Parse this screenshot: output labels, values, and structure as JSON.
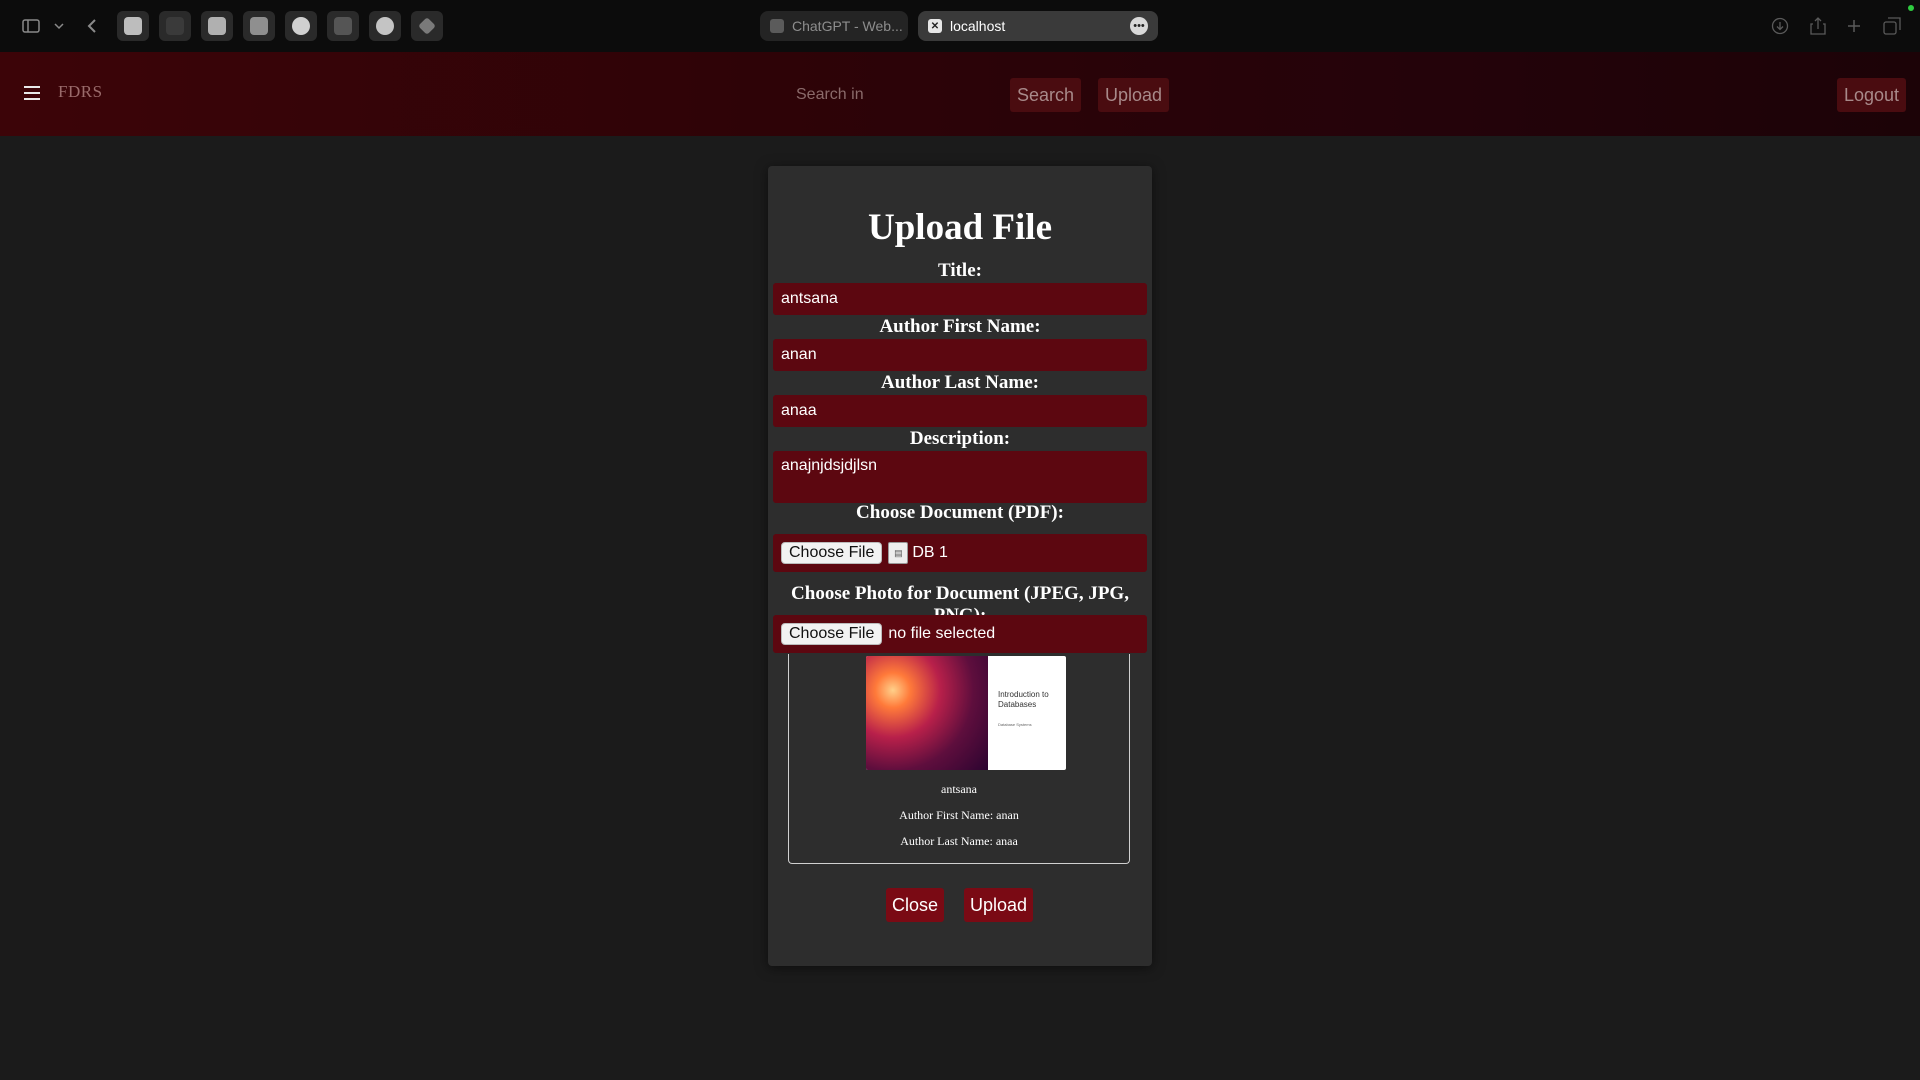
{
  "browser": {
    "tabs": [
      {
        "label": "ChatGPT - Web..."
      },
      {
        "label": "localhost"
      }
    ],
    "tab_more_icon": "ellipsis-icon"
  },
  "navbar": {
    "logo": "FDRS",
    "search_placeholder": "Search in",
    "search_button": "Search",
    "upload_button": "Upload",
    "logout_button": "Logout"
  },
  "modal": {
    "title": "Upload File",
    "labels": {
      "title": "Title:",
      "first_name": "Author First Name:",
      "last_name": "Author Last Name:",
      "description": "Description:",
      "document": "Choose Document (PDF):",
      "photo": "Choose Photo for Document (JPEG, JPG, PNG):"
    },
    "values": {
      "title": "antsana",
      "first_name": "anan",
      "last_name": "anaa",
      "description": "anajnjdsjdjlsn"
    },
    "document_file": {
      "button": "Choose File",
      "name": "DB 1"
    },
    "photo_file": {
      "button": "Choose File",
      "name": "no file selected"
    },
    "preview": {
      "cover_title": "Introduction to Databases",
      "cover_subtitle": "Database Systems",
      "title": "antsana",
      "first_name": "Author First Name: anan",
      "last_name": "Author Last Name: anaa"
    },
    "close_button": "Close",
    "upload_button": "Upload"
  },
  "colors": {
    "accent": "#7a0a14",
    "field_bg": "#5c0710",
    "modal_bg": "#2d2d2d",
    "page_bg": "#1b1b1b"
  }
}
